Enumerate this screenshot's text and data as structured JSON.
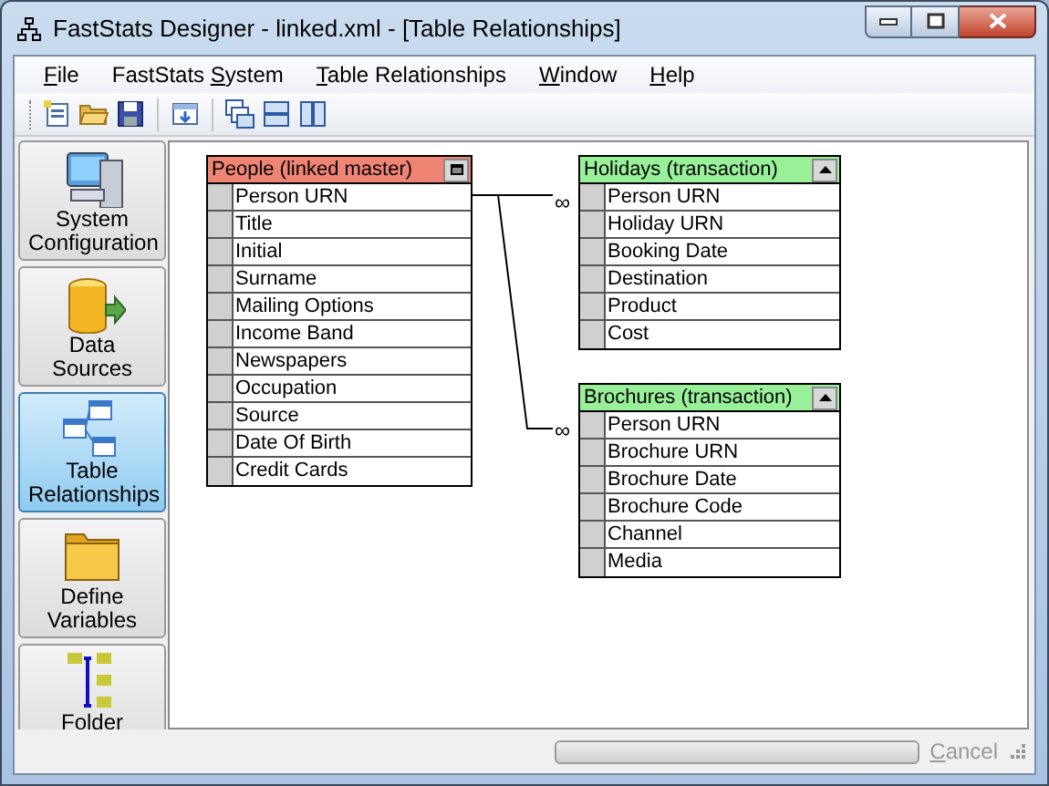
{
  "window": {
    "title": "FastStats Designer - linked.xml - [Table Relationships]"
  },
  "menu": [
    {
      "parts": [
        {
          "text": "F",
          "underlined": true
        },
        {
          "text": "ile",
          "underlined": false
        }
      ]
    },
    {
      "parts": [
        {
          "text": "FastStats ",
          "underlined": false
        },
        {
          "text": "S",
          "underlined": true
        },
        {
          "text": "ystem",
          "underlined": false
        }
      ]
    },
    {
      "parts": [
        {
          "text": "T",
          "underlined": true
        },
        {
          "text": "able Relationships",
          "underlined": false
        }
      ]
    },
    {
      "parts": [
        {
          "text": "W",
          "underlined": true
        },
        {
          "text": "indow",
          "underlined": false
        }
      ]
    },
    {
      "parts": [
        {
          "text": "H",
          "underlined": true
        },
        {
          "text": "elp",
          "underlined": false
        }
      ]
    }
  ],
  "toolbar": [
    {
      "kind": "new"
    },
    {
      "kind": "open"
    },
    {
      "kind": "save"
    },
    {
      "kind": "sep"
    },
    {
      "kind": "import"
    },
    {
      "kind": "sep"
    },
    {
      "kind": "cascade"
    },
    {
      "kind": "horizontal"
    },
    {
      "kind": "vertical"
    }
  ],
  "sidebar": {
    "items": [
      {
        "label": "System Configuration",
        "kind": "computer",
        "selected": false
      },
      {
        "label": "Data Sources",
        "kind": "database",
        "selected": false
      },
      {
        "label": "Table Relationships",
        "kind": "tables",
        "selected": true
      },
      {
        "label": "Define Variables",
        "kind": "folder",
        "selected": false
      },
      {
        "label": "Folder",
        "kind": "tree",
        "selected": false
      }
    ]
  },
  "tables": [
    {
      "title": "People (linked master)",
      "color": "#f08474",
      "kind": "master",
      "fields": [
        "Person URN",
        "Title",
        "Initial",
        "Surname",
        "Mailing Options",
        "Income Band",
        "Newspapers",
        "Occupation",
        "Source",
        "Date Of Birth",
        "Credit Cards"
      ]
    },
    {
      "title": "Holidays (transaction)",
      "color": "#98f098",
      "kind": "transaction",
      "fields": [
        "Person URN",
        "Holiday URN",
        "Booking Date",
        "Destination",
        "Product",
        "Cost"
      ]
    },
    {
      "title": "Brochures (transaction)",
      "color": "#98f098",
      "kind": "transaction",
      "fields": [
        "Person URN",
        "Brochure URN",
        "Brochure Date",
        "Brochure Code",
        "Channel",
        "Media"
      ]
    }
  ],
  "relationships": [
    {
      "cardinality": "∞"
    },
    {
      "cardinality": "∞"
    }
  ],
  "status_bar": {
    "progress": {
      "level": 0
    },
    "cancel": {
      "parts": [
        {
          "text": "C",
          "underlined": true
        },
        {
          "text": "ancel",
          "underlined": false
        }
      ],
      "disabled": true
    }
  }
}
